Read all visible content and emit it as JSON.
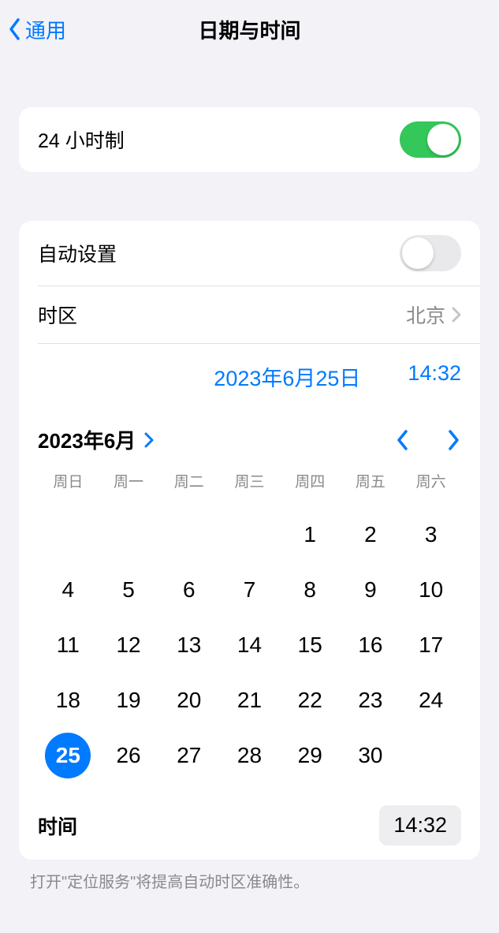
{
  "nav": {
    "back": "通用",
    "title": "日期与时间"
  },
  "twentyFour": {
    "label": "24 小时制",
    "on": true
  },
  "autoSet": {
    "label": "自动设置",
    "on": false
  },
  "timezone": {
    "label": "时区",
    "value": "北京"
  },
  "current": {
    "date": "2023年6月25日",
    "time": "14:32"
  },
  "calendar": {
    "monthLabel": "2023年6月",
    "dow": [
      "周日",
      "周一",
      "周二",
      "周三",
      "周四",
      "周五",
      "周六"
    ],
    "startOffset": 4,
    "daysInMonth": 30,
    "selectedDay": 25
  },
  "timeRow": {
    "label": "时间",
    "value": "14:32"
  },
  "footer": "打开\"定位服务\"将提高自动时区准确性。"
}
